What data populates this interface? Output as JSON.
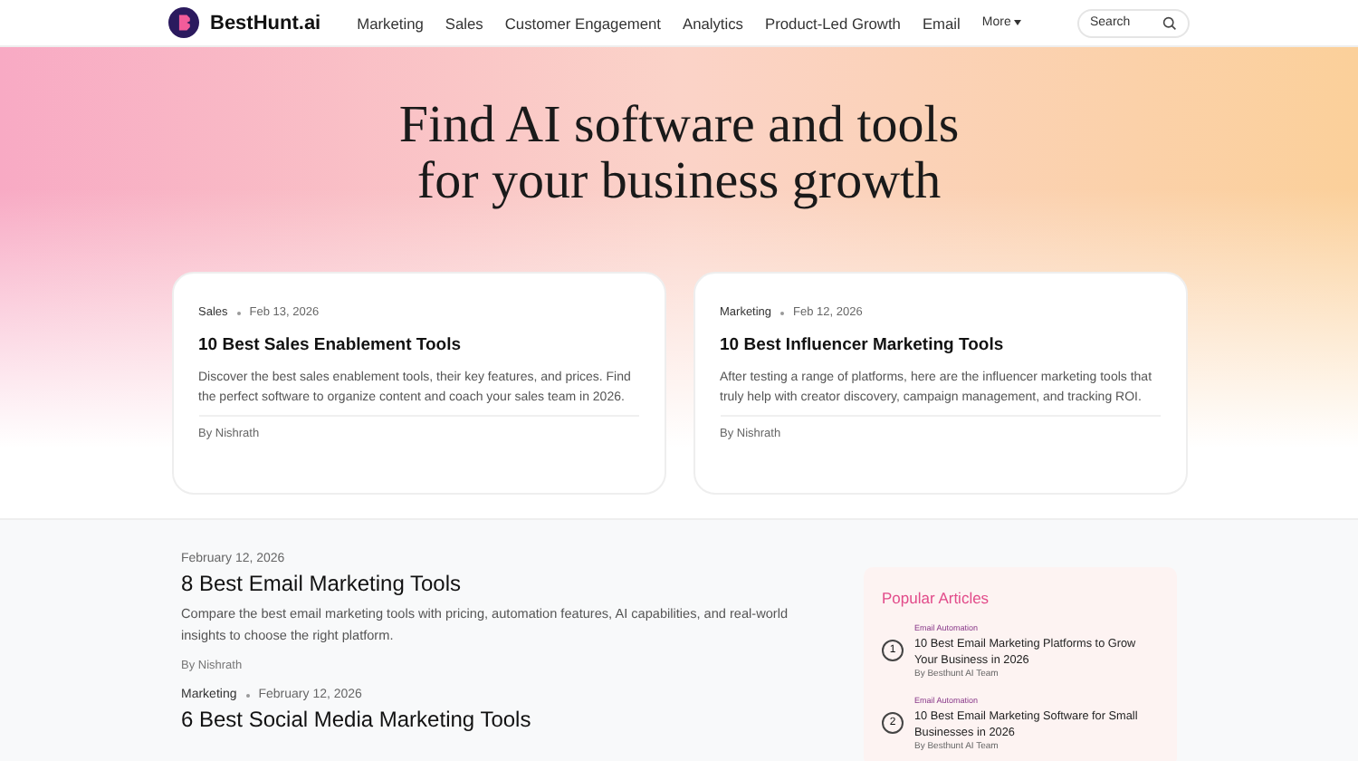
{
  "brand": {
    "name": "BestHunt.ai"
  },
  "nav": {
    "items": [
      "Marketing",
      "Sales",
      "Customer Engagement",
      "Analytics",
      "Product-Led Growth",
      "Email"
    ],
    "more": "More",
    "search": {
      "placeholder": "Search"
    }
  },
  "hero": {
    "title_lines": [
      "Find AI software and tools",
      "for your business growth"
    ]
  },
  "featured": [
    {
      "category": "Sales",
      "date": "Feb 13, 2026",
      "title": "10 Best Sales Enablement Tools",
      "summary": "Discover the best sales enablement tools, their key features, and prices. Find the perfect software to organize content and coach your sales team in 2026.",
      "author": "By Nishrath"
    },
    {
      "category": "Marketing",
      "date": "Feb 12, 2026",
      "title": "10 Best Influencer Marketing Tools",
      "summary": "After testing a range of platforms, here are the influencer marketing tools that truly help with creator discovery, campaign management, and tracking ROI.",
      "author": "By Nishrath"
    }
  ],
  "articles": [
    {
      "date": "February 12, 2026",
      "title": "8 Best Email Marketing Tools",
      "summary": "Compare the best email marketing tools with pricing, automation features, AI capabilities, and real-world insights to choose the right platform.",
      "author": "By Nishrath"
    },
    {
      "category": "Marketing",
      "date": "February 12, 2026",
      "title": "6 Best Social Media Marketing Tools"
    }
  ],
  "popular": {
    "heading": "Popular Articles",
    "items": [
      {
        "number": "1",
        "tag": "Email Automation",
        "title": "10 Best Email Marketing Platforms to Grow Your Business in 2026",
        "author": "By Besthunt AI Team"
      },
      {
        "number": "2",
        "tag": "Email Automation",
        "title": "10 Best Email Marketing Software for Small Businesses in 2026",
        "author": "By Besthunt AI Team"
      }
    ]
  }
}
